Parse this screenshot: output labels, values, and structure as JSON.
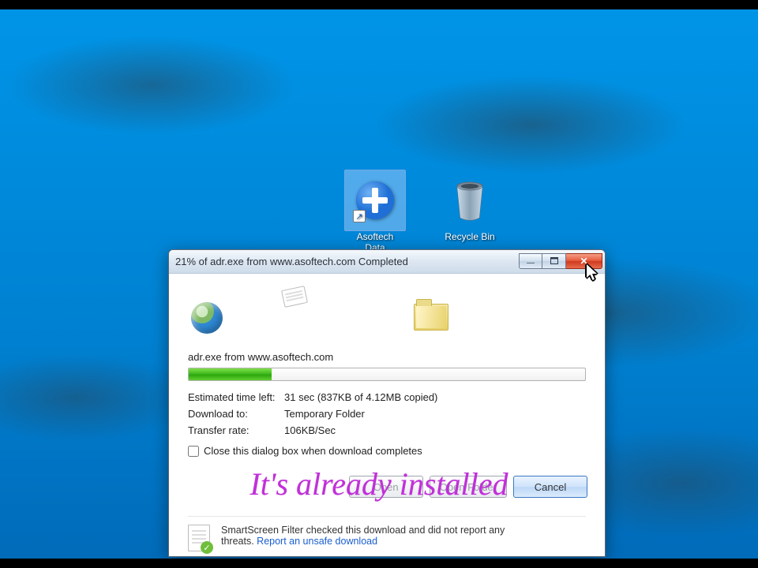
{
  "desktop": {
    "icons": [
      {
        "name": "asoftech",
        "label": "Asoftech\nData",
        "selected": true
      },
      {
        "name": "recyclebin",
        "label": "Recycle Bin",
        "selected": false
      }
    ]
  },
  "dialog": {
    "title": "21% of adr.exe from www.asoftech.com Completed",
    "file_line": "adr.exe from www.asoftech.com",
    "progress_percent": 21,
    "stats": {
      "eta_label": "Estimated time left:",
      "eta_value": "31 sec (837KB of 4.12MB copied)",
      "dest_label": "Download to:",
      "dest_value": "Temporary Folder",
      "rate_label": "Transfer rate:",
      "rate_value": "106KB/Sec"
    },
    "checkbox_label": "Close this dialog box when download completes",
    "buttons": {
      "open": "Open",
      "open_folder": "Open Folder",
      "cancel": "Cancel"
    },
    "smartscreen": {
      "line1": "SmartScreen Filter checked this download and did not report any",
      "line2_prefix": "threats. ",
      "link": "Report an unsafe download"
    }
  },
  "overlay_caption": "It's already installed"
}
